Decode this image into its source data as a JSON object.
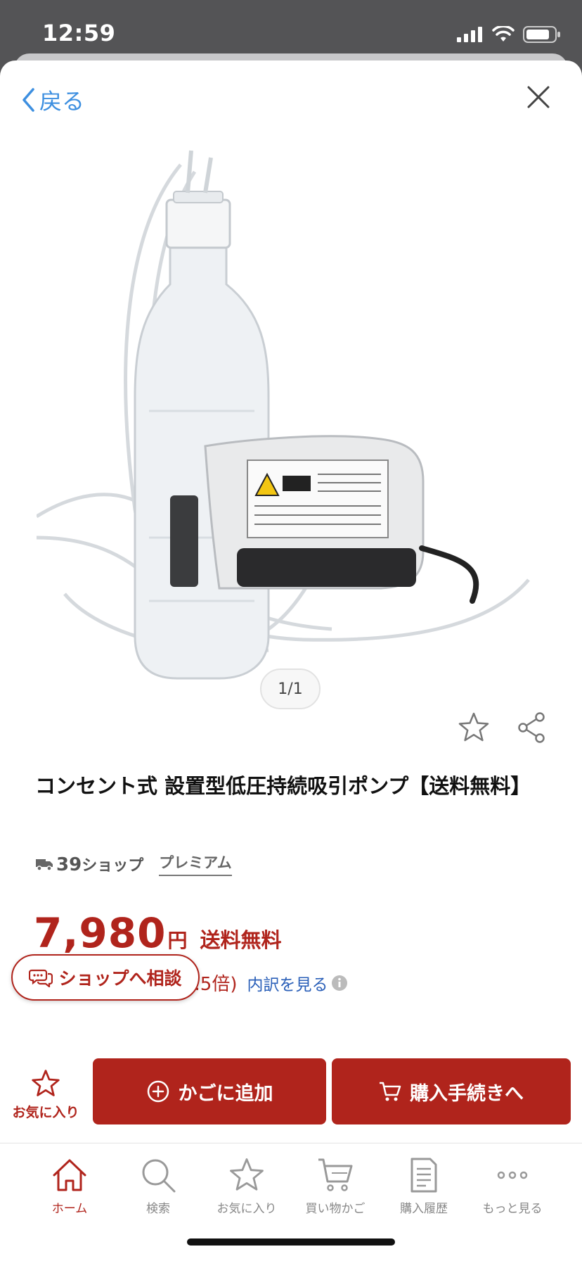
{
  "status_bar": {
    "time": "12:59"
  },
  "nav": {
    "back_label": "戻る"
  },
  "product": {
    "image_counter": "1/1",
    "title": "コンセント式 設置型低圧持続吸引ポンプ【送料無料】",
    "shop_number": "39",
    "shop_suffix": "ショップ",
    "premium_label": "プレミアム",
    "price": "7,980",
    "currency": "円",
    "shipping": "送料無料",
    "points": "5.5倍)",
    "breakdown_link": "内訳を見る"
  },
  "actions": {
    "consult": "ショップへ相談",
    "favorite": "お気に入り",
    "add_to_cart": "かごに追加",
    "checkout": "購入手続きへ"
  },
  "tabs": [
    {
      "label": "ホーム",
      "icon": "home-icon",
      "active": true
    },
    {
      "label": "検索",
      "icon": "search-icon"
    },
    {
      "label": "お気に入り",
      "icon": "star-icon"
    },
    {
      "label": "買い物かご",
      "icon": "cart-icon"
    },
    {
      "label": "購入履歴",
      "icon": "receipt-icon"
    },
    {
      "label": "もっと見る",
      "icon": "more-icon"
    }
  ],
  "colors": {
    "accent": "#b0241c",
    "link": "#2a5fb8",
    "back": "#3d8fe0"
  }
}
